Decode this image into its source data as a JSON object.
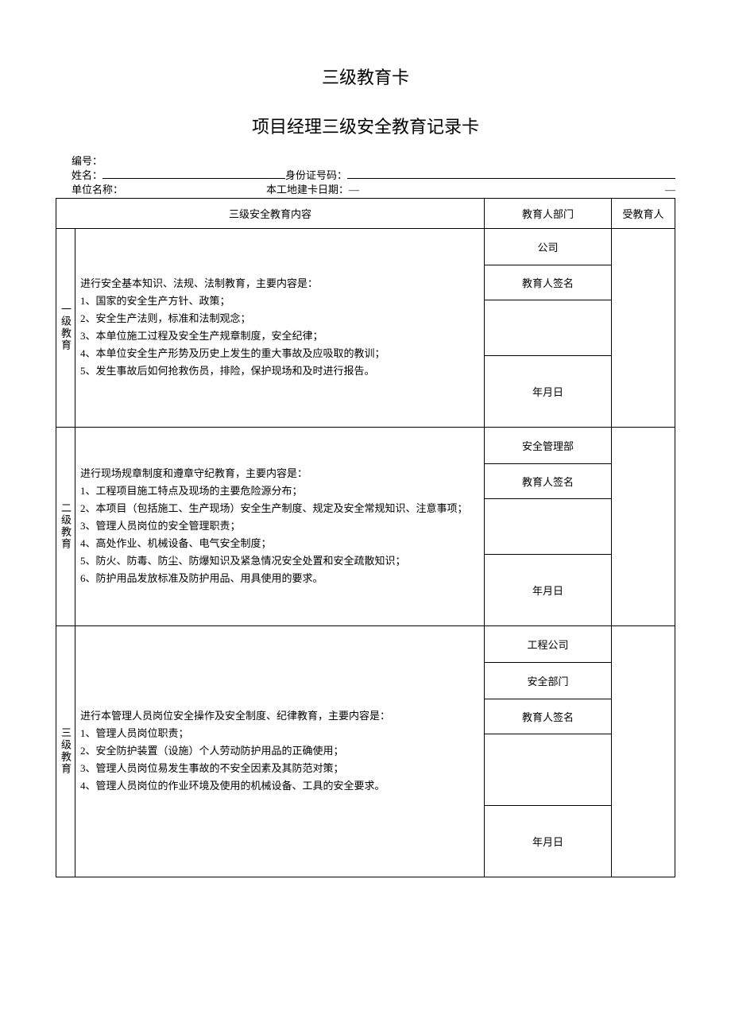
{
  "title_main": "三级教育卡",
  "title_sub": "项目经理三级安全教育记录卡",
  "meta": {
    "serial_label": "编号：",
    "name_label": "姓名：",
    "id_label": "身份证号码：",
    "unit_label": "单位名称：",
    "site_date_label": "本工地建卡日期：",
    "dash": "—",
    "trailing_dash": "—"
  },
  "headers": {
    "content": "三级安全教育内容",
    "dept": "教育人部门",
    "trainee": "受教育人"
  },
  "levels": [
    {
      "label": "一级教育",
      "content": "进行安全基本知识、法规、法制教育，主要内容是：\n1、国家的安全生产方针、政策；\n2、安全生产法则，标准和法制观念；\n3、本单位施工过程及安全生产规章制度，安全纪律；\n4、本单位安全生产形势及历史上发生的重大事故及应吸取的教训；\n5、发生事故后如何抢救伤员，排险，保护现场和及时进行报告。",
      "dept_rows": [
        "公司",
        "教育人签名"
      ],
      "date": "年月日"
    },
    {
      "label": "二级教育",
      "content": "进行现场规章制度和遵章守纪教育，主要内容是：\n1、工程项目施工特点及现场的主要危险源分布；\n2、本项目（包括施工、生产现场）安全生产制度、规定及安全常规知识、注意事项；\n3、管理人员岗位的安全管理职责；\n4、高处作业、机械设备、电气安全制度；\n5、防火、防毒、防尘、防爆知识及紧急情况安全处置和安全疏散知识；\n6、防护用品发放标准及防护用品、用具使用的要求。",
      "dept_rows": [
        "安全管理部",
        "教育人签名"
      ],
      "date": "年月日"
    },
    {
      "label": "三级教育",
      "content": "进行本管理人员岗位安全操作及安全制度、纪律教育，主要内容是：\n1、管理人员岗位职责；\n2、安全防护装置（设施）个人劳动防护用品的正确使用；\n3、管理人员岗位易发生事故的不安全因素及其防范对策；\n4、管理人员岗位的作业环境及使用的机械设备、工具的安全要求。",
      "dept_rows": [
        "工程公司",
        "安全部门",
        "教育人签名"
      ],
      "date": "年月日"
    }
  ]
}
